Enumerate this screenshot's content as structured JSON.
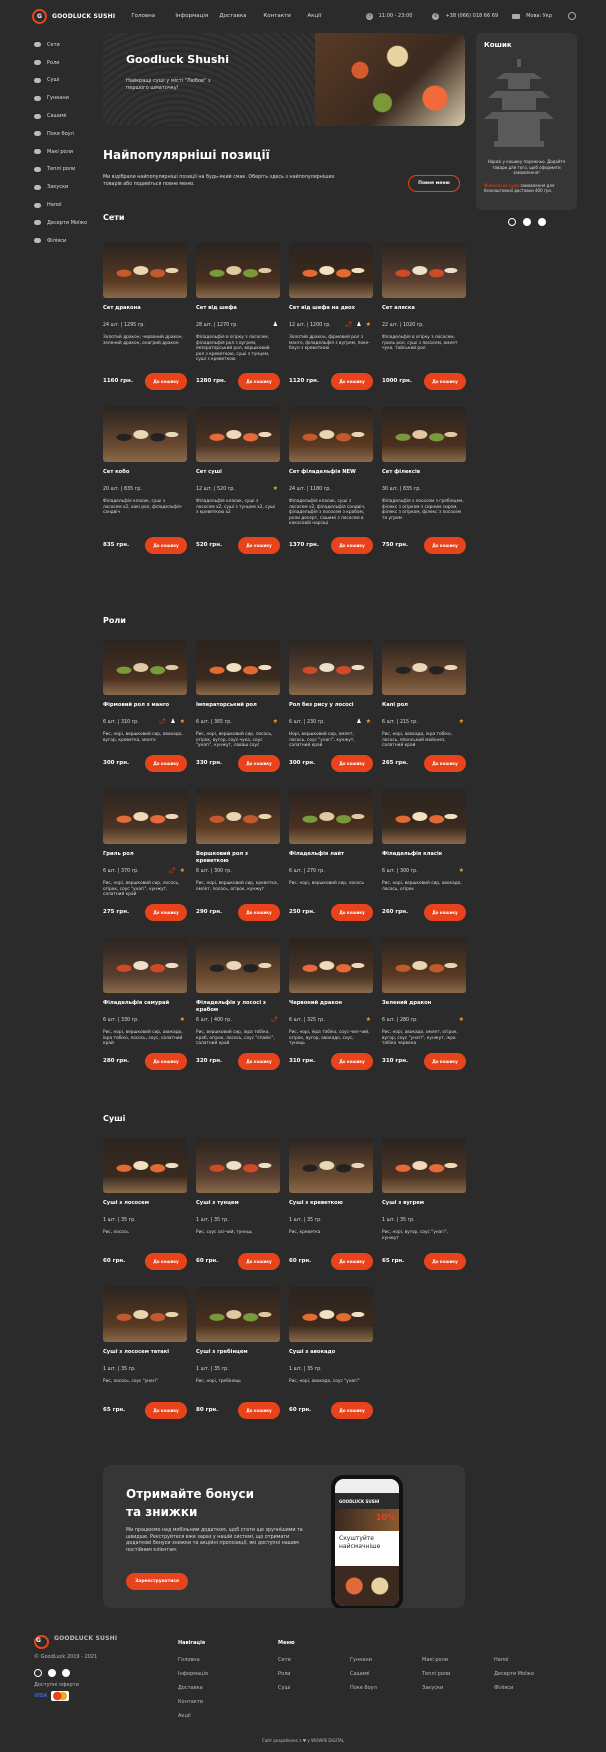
{
  "header": {
    "logo": "GOODLUCK SUSHI",
    "nav": [
      "Головна",
      "Інформація",
      "Доставка",
      "Контакти",
      "Акції"
    ],
    "hours": "11:00 - 23:00",
    "phone": "+38 (066) 018 66 69",
    "language": "Мова: Укр"
  },
  "sidebar": [
    "Сети",
    "Роли",
    "Суші",
    "Гункани",
    "Сашимі",
    "Поке боул",
    "Макі роли",
    "Теплі роли",
    "Закуски",
    "Напої",
    "Десерти Моїжо",
    "Філіяси"
  ],
  "hero": {
    "title": "Goodluck Shushi",
    "subtitle": "Найкращі суші у місті \"Любов\" з першого шматочку!"
  },
  "cart": {
    "title": "Кошик",
    "empty": "Наразі у кошику порожньо. Додайте товари для того, щоб оформити замовлення!",
    "min_label": "Мінімальна сума",
    "min_text": "замовлення для безкоштовної доставки 400 грн."
  },
  "popular": {
    "title": "Найпопулярніші позиції",
    "text": "Ми відібрали найпопулярніші позиції на будь-який смак. Оберіть здесь з найпопулярніших товарів або подивіться повне меню.",
    "button": "Повне меню"
  },
  "sections": [
    {
      "title": "Сети",
      "items": [
        {
          "name": "Сет дракона",
          "weight": "24 шт. | 1295 гр.",
          "desc": "Золотий дракон, червоний дракон, зелений дракон, онагрий дракон",
          "price": "1160 грн.",
          "badges": []
        },
        {
          "name": "Сет від шефа",
          "weight": "28 шт. | 1270 гр.",
          "desc": "Філадельфія в огірку з лососем, філадельфія рол з вугрем, імператорський рол, вершковий рол з креветкою, суші з тунцем, суші з креветкою",
          "price": "1280 грн.",
          "badges": [
            "chef"
          ]
        },
        {
          "name": "Сет від шефа на двох",
          "weight": "12 шт. | 1200 гр.",
          "desc": "Золотий дракон, фірмовий рол з манго, філадельфія з вугрем, поке-боул з креветкою",
          "price": "1120 грн.",
          "badges": [
            "spicy",
            "chef",
            "star"
          ]
        },
        {
          "name": "Сет аляска",
          "weight": "22 шт. | 1020 гр.",
          "desc": "Філадельфія в огірку з лососем, гриль рол, суші з лососем, омлет чука, тайський рол",
          "price": "1000 грн.",
          "badges": []
        },
        {
          "name": "Сет кобо",
          "weight": "20 шт. | 835 гр.",
          "desc": "Філадельфія класик, суші з лососем х2, хакі рол, філадельфія-сандвіч",
          "price": "835 грн.",
          "badges": []
        },
        {
          "name": "Сет суші",
          "weight": "12 шт. | 520 гр.",
          "desc": "Філадельфія класик, суші з лососем х2, суші з тунцем х2, суші з креветкою х2",
          "price": "520 грн.",
          "badges": [
            "star"
          ]
        },
        {
          "name": "Сет філадельфія NEW",
          "weight": "24 шт. | 1180 гр.",
          "desc": "Філадельфія класик, суші з лососем х2, філадельфія сандвіч, філадельфія з лососем з крабом, роли десерт, сашимі з лососем в кокосовій нарізці",
          "price": "1370 грн.",
          "badges": []
        },
        {
          "name": "Сет філексів",
          "weight": "30 шт. | 835 гр.",
          "desc": "Філадельфія з лососем з гребінцем, філекс з огірком з сирним сиром, філекс з огірком, філекс з лососем та угрем",
          "price": "750 грн.",
          "badges": []
        }
      ]
    },
    {
      "title": "Роли",
      "items": [
        {
          "name": "Фірмовий рол з манго",
          "weight": "6 шт. | 310 гр.",
          "desc": "Рис, норі, вершковий сир, авокадо, вугор, креветка, манго",
          "price": "300 грн.",
          "badges": [
            "spicy",
            "chef",
            "star"
          ]
        },
        {
          "name": "Імператорський рол",
          "weight": "6 шт. | 365 гр.",
          "desc": "Рис, норі, вершковий сир, лосось, огірок, вугор, соус-чука, соус \"унагі\", кунжут, лаваш соус",
          "price": "330 грн.",
          "badges": [
            "star"
          ]
        },
        {
          "name": "Рол без рису у лососі",
          "weight": "6 шт. | 230 гр.",
          "desc": "Норі, вершковий сир, омлет, лосось, соус \"унагі\", кунжут, салатний край",
          "price": "300 грн.",
          "badges": [
            "chef",
            "star"
          ]
        },
        {
          "name": "Капі рол",
          "weight": "6 шт. | 215 гр.",
          "desc": "Рис, норі, авокадо, ікра тобіко, лосось, японський майонез, салатний край",
          "price": "265 грн.",
          "badges": [
            "star"
          ]
        },
        {
          "name": "Гриль рол",
          "weight": "6 шт. | 370 гр.",
          "desc": "Рис, норі, вершковий сир, лосось, огірок, соус \"унагі\", кунжут, салатний край",
          "price": "275 грн.",
          "badges": [
            "spicy",
            "star"
          ]
        },
        {
          "name": "Вершковий рол з креветкою",
          "weight": "6 шт. | 300 гр.",
          "desc": "Рис, норі, вершковий сир, креветка, омлет, лосось, огірок, кунжут",
          "price": "290 грн.",
          "badges": []
        },
        {
          "name": "Філадельфія лайт",
          "weight": "6 шт. | 270 гр.",
          "desc": "Рис, норі, вершковий сир, лосось",
          "price": "250 грн.",
          "badges": []
        },
        {
          "name": "Філадельфія класік",
          "weight": "6 шт. | 300 гр.",
          "desc": "Рис, норі, вершковий сир, авокадо, лосось, огірок",
          "price": "260 грн.",
          "badges": [
            "star"
          ]
        },
        {
          "name": "Філадельфія самурай",
          "weight": "6 шт. | 330 гр.",
          "desc": "Рис, норі, вершковий сир, авокадо, ікра тобіко, лосось, соус, салатний край",
          "price": "280 грн.",
          "badges": [
            "star"
          ]
        },
        {
          "name": "Філадельфія у лососі з крабом",
          "weight": "6 шт. | 400 гр.",
          "desc": "Рис, вершковий сир, ікра тобіко, краб, огірок, лосось, соус \"спайсі\", салатний край",
          "price": "320 грн.",
          "badges": [
            "spicy"
          ]
        },
        {
          "name": "Червоний дракон",
          "weight": "6 шт. | 325 гр.",
          "desc": "Рис, норі, ікра тобіко, соус-чил-чий, огірок, вугор, авокадо, соус, тунець",
          "price": "310 грн.",
          "badges": [
            "star"
          ]
        },
        {
          "name": "Зелений дракон",
          "weight": "6 шт. | 280 гр.",
          "desc": "Рис, норі, авокадо, омлет, огірок, вугор, соус \"унагі\", кунжут, ікра тобіко червона",
          "price": "310 грн.",
          "badges": [
            "star"
          ]
        }
      ]
    },
    {
      "title": "Суші",
      "items": [
        {
          "name": "Суші з лососем",
          "weight": "1 шт. | 35 гр.",
          "desc": "Рис, лосось",
          "price": "60 грн.",
          "badges": []
        },
        {
          "name": "Суші з тунцем",
          "weight": "1 шт. | 35 гр.",
          "desc": "Рис, соус сві-чий, тунець",
          "price": "60 грн.",
          "badges": []
        },
        {
          "name": "Суші з креветкою",
          "weight": "1 шт. | 35 гр.",
          "desc": "Рис, креветка",
          "price": "60 грн.",
          "badges": []
        },
        {
          "name": "Суші з вугрем",
          "weight": "1 шт. | 35 гр.",
          "desc": "Рис, норі, вугор, соус \"унагі\", кунжут",
          "price": "65 грн.",
          "badges": []
        },
        {
          "name": "Суші з лососем татакі",
          "weight": "1 шт. | 35 гр.",
          "desc": "Рис, лосось, соус \"унагі\"",
          "price": "65 грн.",
          "badges": []
        },
        {
          "name": "Суші з гребінцем",
          "weight": "1 шт. | 35 гр.",
          "desc": "Рис, норі, гребінець",
          "price": "80 грн.",
          "badges": []
        },
        {
          "name": "Суші з авокадо",
          "weight": "1 шт. | 35 гр.",
          "desc": "Рис, норі, авокадо, соус \"унагі\"",
          "price": "60 грн.",
          "badges": []
        }
      ]
    }
  ],
  "add_button": "До кошику",
  "promo": {
    "title": "Отримайте бонуси та знижки",
    "text": "Ми працюємо над мобільним додатком, щоб стати ще зручнішими та швидше. Реєструйтеся вже зараз у нашій системі, що отримати додаткові бонуси знижки та акційні пропозиції, які доступні нашим постійним клієнтам.",
    "button": "Зареєструватися",
    "phone_logo": "GOODLUCK SUSHI",
    "phone_discount": "10%",
    "phone_headline": "Скуштуйте найсмачніше"
  },
  "footer": {
    "logo": "GOODLUCK SUSHI",
    "copyright": "© GoodLuck 2019 - 2021",
    "payment_title": "Доступні оферти",
    "nav_title": "Навігація",
    "nav": [
      "Головна",
      "Інформація",
      "Доставка",
      "Контакти",
      "Акції"
    ],
    "menu_title": "Меню",
    "menu": [
      "Сети",
      "Роли",
      "Суші",
      "Гункани",
      "Сашимі",
      "Поке боул",
      "Макі роли",
      "Теплі роли",
      "Закуски",
      "Напої",
      "Десерти Моїжо",
      "Філіяси"
    ],
    "credit": "Сайт розроблено з ♥ у WOWPE DIGITAL"
  },
  "colors": {
    "accent": "#e9431b",
    "bg": "#2b2b2b",
    "panel": "#363636"
  }
}
